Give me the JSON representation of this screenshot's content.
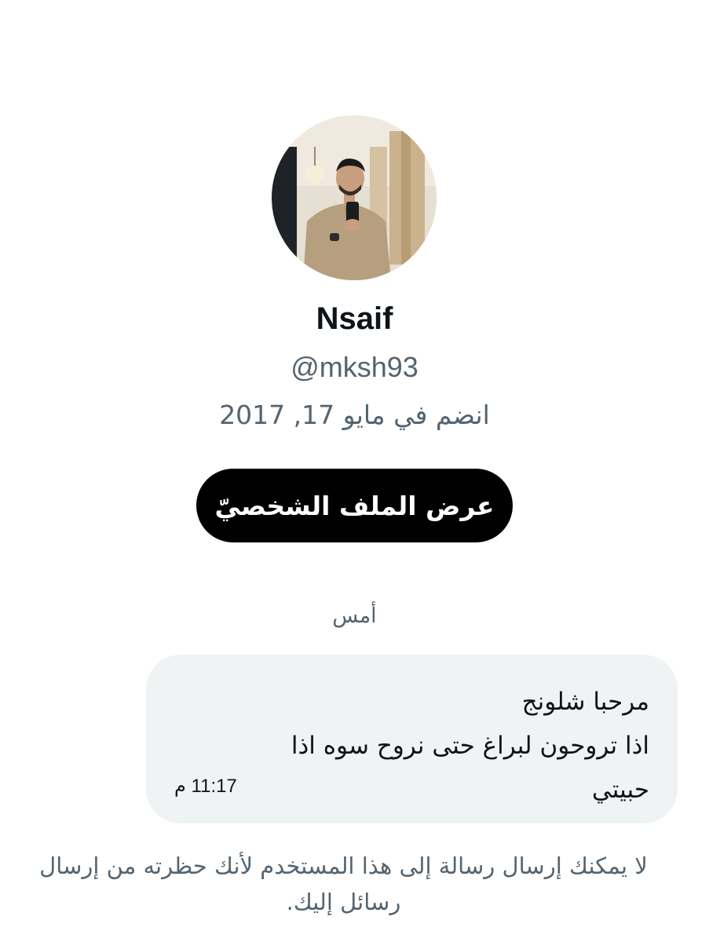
{
  "profile": {
    "avatar_icon": "avatar",
    "name": "Nsaif",
    "handle": "@mksh93",
    "joined": "انضم في مايو 17, 2017",
    "view_profile_label": "عرض الملف الشخصيّ"
  },
  "conversation": {
    "date_separator": "أمس",
    "messages": [
      {
        "lines": [
          "مرحبا شلونج",
          "اذا تروحون لبراغ حتى نروح سوه اذا",
          "حبيتي"
        ],
        "time": "11:17 م"
      }
    ],
    "blocked_notice": "لا يمكنك إرسال رسالة إلى هذا المستخدم لأنك حظرته من إرسال رسائل إليك."
  },
  "colors": {
    "primary_text": "#0f1419",
    "secondary_text": "#536471",
    "bubble_bg": "#eff3f4",
    "button_bg": "#000000",
    "button_text": "#ffffff"
  }
}
